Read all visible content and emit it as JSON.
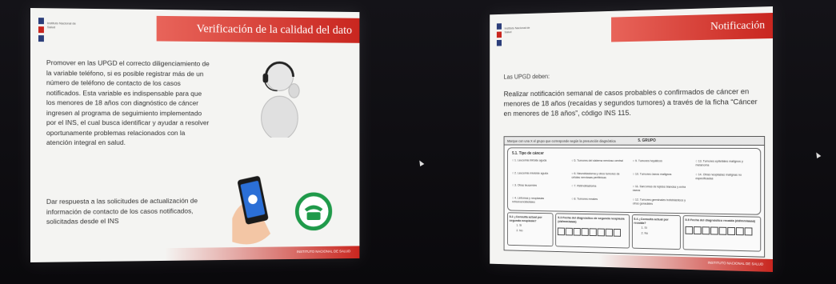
{
  "left_slide": {
    "title": "Verificación de la calidad del dato",
    "logo_text": "Instituto Nacional de Salud",
    "paragraph_1": "Promover en las UPGD el correcto diligenciamiento de la variable teléfono, si es posible registrar más de un número de teléfono de contacto de los casos notificados. Esta variable es indispensable para que los menores de 18 años con diagnóstico de cáncer ingresen al programa de seguimiento implementado por el INS, el cual busca identificar y ayudar a resolver oportunamente problemas relacionados con la atención integral en salud.",
    "paragraph_2": "Dar respuesta a las solicitudes de actualización de información de contacto de los casos notificados, solicitadas desde el INS",
    "footer": "INSTITUTO NACIONAL DE SALUD",
    "icons": [
      "headset-person-icon",
      "smartphone-call-icon",
      "telephone-icon"
    ]
  },
  "right_slide": {
    "title": "Notificación",
    "logo_text": "Instituto Nacional de Salud",
    "intro": "Las UPGD deben:",
    "paragraph": "Realizar notificación semanal de casos probables o confirmados de cáncer en menores de 18 años (recaídas y segundos tumores) a través de la ficha “Cáncer en menores de 18 años”, código INS 115.",
    "form": {
      "header_note": "Marque con una X el grupo que corresponde según la presunción diagnóstica",
      "header_title": "5. GRUPO",
      "section_title": "5.1. Tipo de cáncer",
      "options": [
        "1. Leucemia linfoide aguda",
        "2. Leucemia mieloide aguda",
        "3. Otras leucemias",
        "4. Linfomas y neoplasias reticuloendoteliales",
        "5. Tumores del sistema nervioso central",
        "6. Neuroblastoma y otros tumores de células nerviosas periféricas",
        "7. Retinoblastoma",
        "8. Tumores renales",
        "9. Tumores hepáticos",
        "10. Tumores óseos malignos",
        "11. Sarcomas de tejidos blandos y extra óseos",
        "12. Tumores germinales trofoblásticos y otros gonadales",
        "13. Tumores epiteliales malignos y melanoma",
        "14. Otras neoplasias malignas no especificadas"
      ],
      "cell_52": "5.2 ¿Consulta actual por segunda neoplasia?",
      "cell_53": "5.3 Fecha del diagnóstico de segunda neoplasia (dd/mm/aaaa)",
      "cell_54": "5.4 ¿Consulta actual por recaída?",
      "cell_55": "5.5 Fecha del diagnóstico recaída (dd/mm/aaaa)",
      "yes": "1. Sí",
      "no": "2. No"
    },
    "footer": "INSTITUTO NACIONAL DE SALUD"
  },
  "colors": {
    "accent_red": "#c9261f",
    "slide_bg": "#f4f4f2",
    "room_bg": "#0d0c10",
    "phone_green": "#1f9a4a"
  }
}
